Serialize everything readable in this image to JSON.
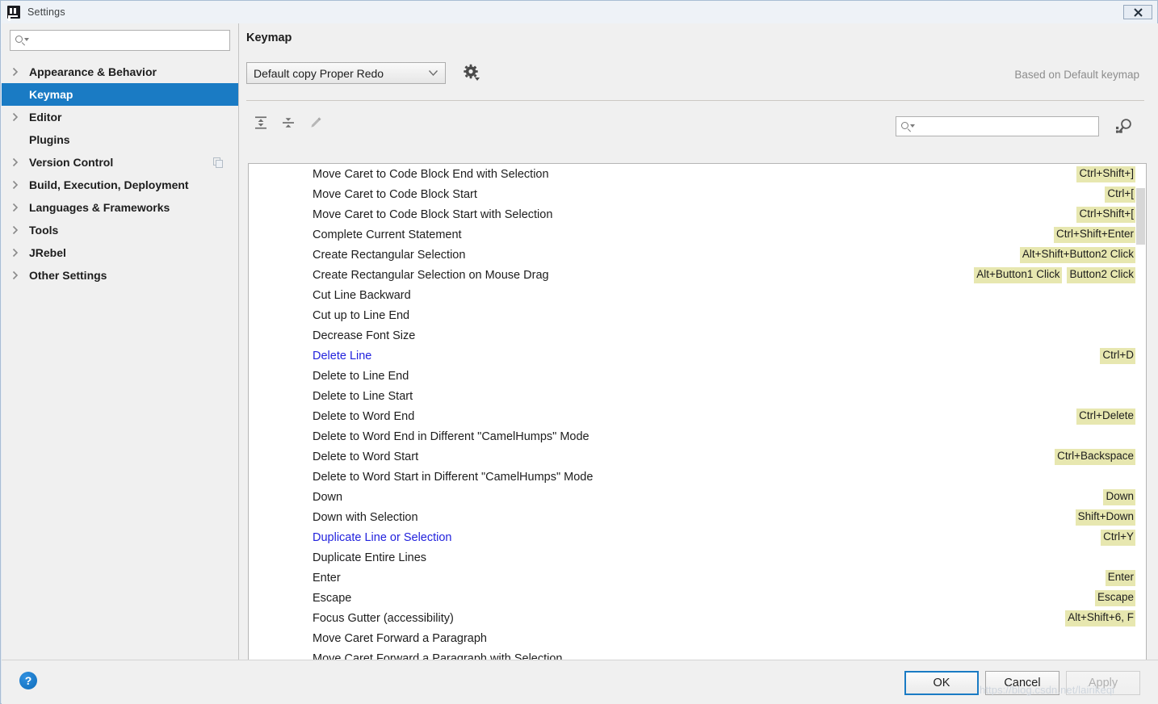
{
  "window": {
    "title": "Settings",
    "logo_icon": "intellij-idea-logo-icon",
    "close_label": "✕"
  },
  "sidebar": {
    "search": {
      "placeholder": "",
      "value": "",
      "icon": "search-icon"
    },
    "items": [
      {
        "label": "Appearance & Behavior",
        "expandable": true,
        "selected": false
      },
      {
        "label": "Keymap",
        "expandable": false,
        "selected": true
      },
      {
        "label": "Editor",
        "expandable": true,
        "selected": false
      },
      {
        "label": "Plugins",
        "expandable": false,
        "selected": false
      },
      {
        "label": "Version Control",
        "expandable": true,
        "selected": false,
        "trailing_icon": "copy-icon"
      },
      {
        "label": "Build, Execution, Deployment",
        "expandable": true,
        "selected": false
      },
      {
        "label": "Languages & Frameworks",
        "expandable": true,
        "selected": false
      },
      {
        "label": "Tools",
        "expandable": true,
        "selected": false
      },
      {
        "label": "JRebel",
        "expandable": true,
        "selected": false
      },
      {
        "label": "Other Settings",
        "expandable": true,
        "selected": false
      }
    ]
  },
  "content": {
    "page_title": "Keymap",
    "keymap_select": {
      "value": "Default copy Proper Redo",
      "chevron_icon": "chevron-down-icon"
    },
    "gear_icon": "gear-icon",
    "based_on": "Based on Default keymap",
    "toolbar": {
      "expand_all_icon": "expand-all-icon",
      "collapse_all_icon": "collapse-all-icon",
      "edit_icon": "pencil-edit-icon"
    },
    "filter": {
      "placeholder": "",
      "value": "",
      "icon": "search-icon",
      "find_by_shortcut_icon": "find-by-shortcut-icon"
    }
  },
  "actions": [
    {
      "name": "Move Caret to Code Block End with Selection",
      "modified": false,
      "shortcuts": [
        "Ctrl+Shift+]"
      ]
    },
    {
      "name": "Move Caret to Code Block Start",
      "modified": false,
      "shortcuts": [
        "Ctrl+["
      ]
    },
    {
      "name": "Move Caret to Code Block Start with Selection",
      "modified": false,
      "shortcuts": [
        "Ctrl+Shift+["
      ]
    },
    {
      "name": "Complete Current Statement",
      "modified": false,
      "shortcuts": [
        "Ctrl+Shift+Enter"
      ]
    },
    {
      "name": "Create Rectangular Selection",
      "modified": false,
      "shortcuts": [
        "Alt+Shift+Button2 Click"
      ]
    },
    {
      "name": "Create Rectangular Selection on Mouse Drag",
      "modified": false,
      "shortcuts": [
        "Alt+Button1 Click",
        "Button2 Click"
      ]
    },
    {
      "name": "Cut Line Backward",
      "modified": false,
      "shortcuts": []
    },
    {
      "name": "Cut up to Line End",
      "modified": false,
      "shortcuts": []
    },
    {
      "name": "Decrease Font Size",
      "modified": false,
      "shortcuts": []
    },
    {
      "name": "Delete Line",
      "modified": true,
      "shortcuts": [
        "Ctrl+D"
      ]
    },
    {
      "name": "Delete to Line End",
      "modified": false,
      "shortcuts": []
    },
    {
      "name": "Delete to Line Start",
      "modified": false,
      "shortcuts": []
    },
    {
      "name": "Delete to Word End",
      "modified": false,
      "shortcuts": [
        "Ctrl+Delete"
      ]
    },
    {
      "name": "Delete to Word End in Different \"CamelHumps\" Mode",
      "modified": false,
      "shortcuts": []
    },
    {
      "name": "Delete to Word Start",
      "modified": false,
      "shortcuts": [
        "Ctrl+Backspace"
      ]
    },
    {
      "name": "Delete to Word Start in Different \"CamelHumps\" Mode",
      "modified": false,
      "shortcuts": []
    },
    {
      "name": "Down",
      "modified": false,
      "shortcuts": [
        "Down"
      ]
    },
    {
      "name": "Down with Selection",
      "modified": false,
      "shortcuts": [
        "Shift+Down"
      ]
    },
    {
      "name": "Duplicate Line or Selection",
      "modified": true,
      "shortcuts": [
        "Ctrl+Y"
      ]
    },
    {
      "name": "Duplicate Entire Lines",
      "modified": false,
      "shortcuts": []
    },
    {
      "name": "Enter",
      "modified": false,
      "shortcuts": [
        "Enter"
      ]
    },
    {
      "name": "Escape",
      "modified": false,
      "shortcuts": [
        "Escape"
      ]
    },
    {
      "name": "Focus Gutter (accessibility)",
      "modified": false,
      "shortcuts": [
        "Alt+Shift+6, F"
      ]
    },
    {
      "name": "Move Caret Forward a Paragraph",
      "modified": false,
      "shortcuts": []
    },
    {
      "name": "Move Caret Forward a Paragraph with Selection",
      "modified": false,
      "shortcuts": []
    }
  ],
  "footer": {
    "help_label": "?",
    "ok_label": "OK",
    "cancel_label": "Cancel",
    "apply_label": "Apply"
  },
  "watermark": "https://blog.csdn.net/lairikeqi",
  "colors": {
    "selection_blue": "#1a7bc4",
    "shortcut_badge": "#e7e7b0",
    "modified_text": "#2222dd",
    "panel_bg": "#f0f0f0"
  }
}
